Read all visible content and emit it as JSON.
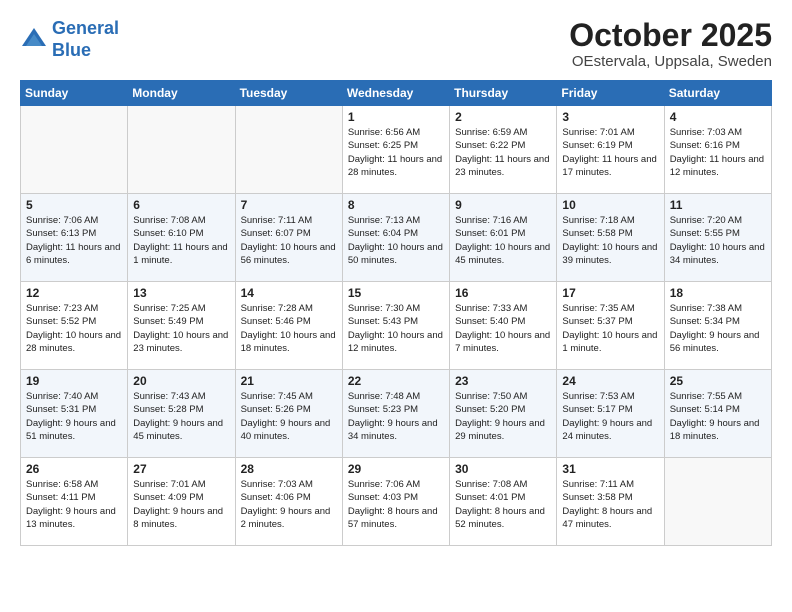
{
  "header": {
    "logo_line1": "General",
    "logo_line2": "Blue",
    "month": "October 2025",
    "location": "OEstervala, Uppsala, Sweden"
  },
  "weekdays": [
    "Sunday",
    "Monday",
    "Tuesday",
    "Wednesday",
    "Thursday",
    "Friday",
    "Saturday"
  ],
  "weeks": [
    [
      {
        "day": "",
        "sunrise": "",
        "sunset": "",
        "daylight": ""
      },
      {
        "day": "",
        "sunrise": "",
        "sunset": "",
        "daylight": ""
      },
      {
        "day": "",
        "sunrise": "",
        "sunset": "",
        "daylight": ""
      },
      {
        "day": "1",
        "sunrise": "Sunrise: 6:56 AM",
        "sunset": "Sunset: 6:25 PM",
        "daylight": "Daylight: 11 hours and 28 minutes."
      },
      {
        "day": "2",
        "sunrise": "Sunrise: 6:59 AM",
        "sunset": "Sunset: 6:22 PM",
        "daylight": "Daylight: 11 hours and 23 minutes."
      },
      {
        "day": "3",
        "sunrise": "Sunrise: 7:01 AM",
        "sunset": "Sunset: 6:19 PM",
        "daylight": "Daylight: 11 hours and 17 minutes."
      },
      {
        "day": "4",
        "sunrise": "Sunrise: 7:03 AM",
        "sunset": "Sunset: 6:16 PM",
        "daylight": "Daylight: 11 hours and 12 minutes."
      }
    ],
    [
      {
        "day": "5",
        "sunrise": "Sunrise: 7:06 AM",
        "sunset": "Sunset: 6:13 PM",
        "daylight": "Daylight: 11 hours and 6 minutes."
      },
      {
        "day": "6",
        "sunrise": "Sunrise: 7:08 AM",
        "sunset": "Sunset: 6:10 PM",
        "daylight": "Daylight: 11 hours and 1 minute."
      },
      {
        "day": "7",
        "sunrise": "Sunrise: 7:11 AM",
        "sunset": "Sunset: 6:07 PM",
        "daylight": "Daylight: 10 hours and 56 minutes."
      },
      {
        "day": "8",
        "sunrise": "Sunrise: 7:13 AM",
        "sunset": "Sunset: 6:04 PM",
        "daylight": "Daylight: 10 hours and 50 minutes."
      },
      {
        "day": "9",
        "sunrise": "Sunrise: 7:16 AM",
        "sunset": "Sunset: 6:01 PM",
        "daylight": "Daylight: 10 hours and 45 minutes."
      },
      {
        "day": "10",
        "sunrise": "Sunrise: 7:18 AM",
        "sunset": "Sunset: 5:58 PM",
        "daylight": "Daylight: 10 hours and 39 minutes."
      },
      {
        "day": "11",
        "sunrise": "Sunrise: 7:20 AM",
        "sunset": "Sunset: 5:55 PM",
        "daylight": "Daylight: 10 hours and 34 minutes."
      }
    ],
    [
      {
        "day": "12",
        "sunrise": "Sunrise: 7:23 AM",
        "sunset": "Sunset: 5:52 PM",
        "daylight": "Daylight: 10 hours and 28 minutes."
      },
      {
        "day": "13",
        "sunrise": "Sunrise: 7:25 AM",
        "sunset": "Sunset: 5:49 PM",
        "daylight": "Daylight: 10 hours and 23 minutes."
      },
      {
        "day": "14",
        "sunrise": "Sunrise: 7:28 AM",
        "sunset": "Sunset: 5:46 PM",
        "daylight": "Daylight: 10 hours and 18 minutes."
      },
      {
        "day": "15",
        "sunrise": "Sunrise: 7:30 AM",
        "sunset": "Sunset: 5:43 PM",
        "daylight": "Daylight: 10 hours and 12 minutes."
      },
      {
        "day": "16",
        "sunrise": "Sunrise: 7:33 AM",
        "sunset": "Sunset: 5:40 PM",
        "daylight": "Daylight: 10 hours and 7 minutes."
      },
      {
        "day": "17",
        "sunrise": "Sunrise: 7:35 AM",
        "sunset": "Sunset: 5:37 PM",
        "daylight": "Daylight: 10 hours and 1 minute."
      },
      {
        "day": "18",
        "sunrise": "Sunrise: 7:38 AM",
        "sunset": "Sunset: 5:34 PM",
        "daylight": "Daylight: 9 hours and 56 minutes."
      }
    ],
    [
      {
        "day": "19",
        "sunrise": "Sunrise: 7:40 AM",
        "sunset": "Sunset: 5:31 PM",
        "daylight": "Daylight: 9 hours and 51 minutes."
      },
      {
        "day": "20",
        "sunrise": "Sunrise: 7:43 AM",
        "sunset": "Sunset: 5:28 PM",
        "daylight": "Daylight: 9 hours and 45 minutes."
      },
      {
        "day": "21",
        "sunrise": "Sunrise: 7:45 AM",
        "sunset": "Sunset: 5:26 PM",
        "daylight": "Daylight: 9 hours and 40 minutes."
      },
      {
        "day": "22",
        "sunrise": "Sunrise: 7:48 AM",
        "sunset": "Sunset: 5:23 PM",
        "daylight": "Daylight: 9 hours and 34 minutes."
      },
      {
        "day": "23",
        "sunrise": "Sunrise: 7:50 AM",
        "sunset": "Sunset: 5:20 PM",
        "daylight": "Daylight: 9 hours and 29 minutes."
      },
      {
        "day": "24",
        "sunrise": "Sunrise: 7:53 AM",
        "sunset": "Sunset: 5:17 PM",
        "daylight": "Daylight: 9 hours and 24 minutes."
      },
      {
        "day": "25",
        "sunrise": "Sunrise: 7:55 AM",
        "sunset": "Sunset: 5:14 PM",
        "daylight": "Daylight: 9 hours and 18 minutes."
      }
    ],
    [
      {
        "day": "26",
        "sunrise": "Sunrise: 6:58 AM",
        "sunset": "Sunset: 4:11 PM",
        "daylight": "Daylight: 9 hours and 13 minutes."
      },
      {
        "day": "27",
        "sunrise": "Sunrise: 7:01 AM",
        "sunset": "Sunset: 4:09 PM",
        "daylight": "Daylight: 9 hours and 8 minutes."
      },
      {
        "day": "28",
        "sunrise": "Sunrise: 7:03 AM",
        "sunset": "Sunset: 4:06 PM",
        "daylight": "Daylight: 9 hours and 2 minutes."
      },
      {
        "day": "29",
        "sunrise": "Sunrise: 7:06 AM",
        "sunset": "Sunset: 4:03 PM",
        "daylight": "Daylight: 8 hours and 57 minutes."
      },
      {
        "day": "30",
        "sunrise": "Sunrise: 7:08 AM",
        "sunset": "Sunset: 4:01 PM",
        "daylight": "Daylight: 8 hours and 52 minutes."
      },
      {
        "day": "31",
        "sunrise": "Sunrise: 7:11 AM",
        "sunset": "Sunset: 3:58 PM",
        "daylight": "Daylight: 8 hours and 47 minutes."
      },
      {
        "day": "",
        "sunrise": "",
        "sunset": "",
        "daylight": ""
      }
    ]
  ]
}
